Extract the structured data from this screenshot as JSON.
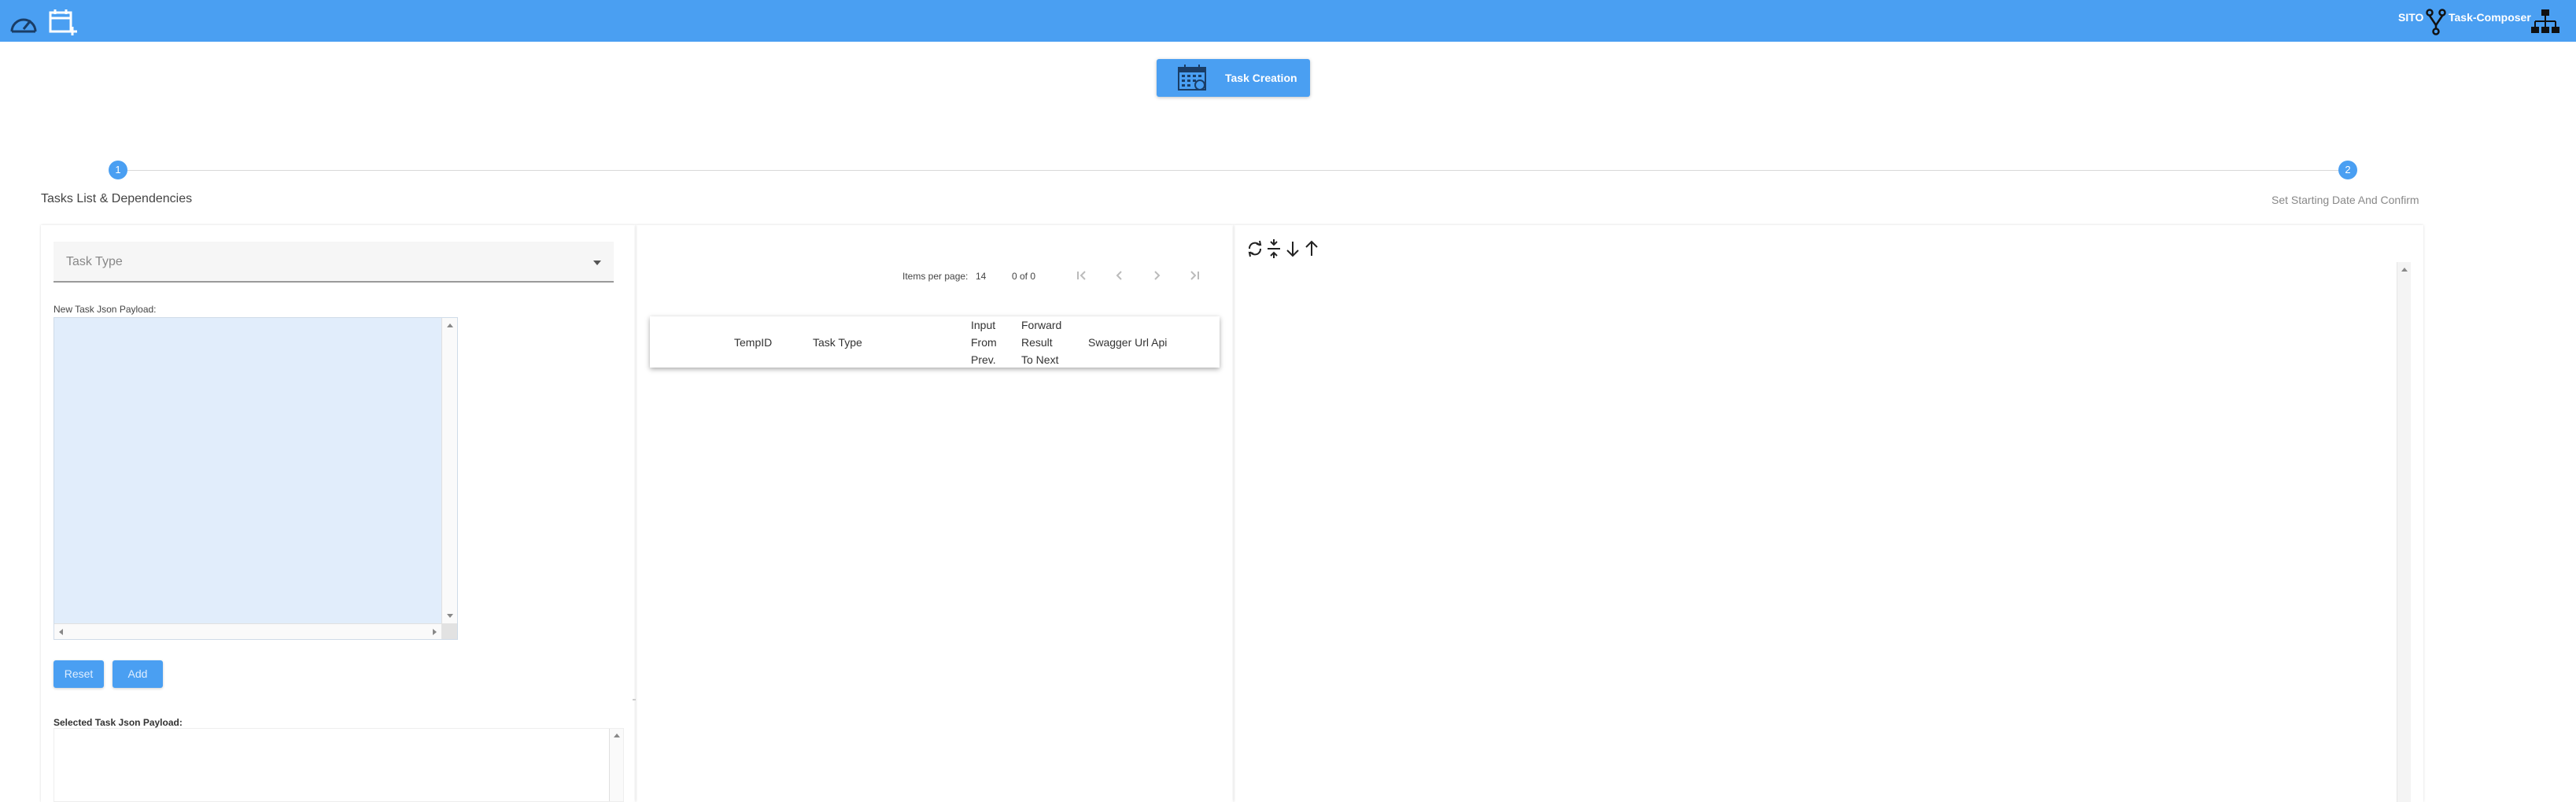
{
  "topbar": {
    "brand_short": "SITO",
    "brand_name": "Task-Composer",
    "icons": [
      "speedometer-icon",
      "calendar-add-icon",
      "fork-icon",
      "sitemap-icon"
    ],
    "color": "#4a9ff2"
  },
  "hero": {
    "label": "Task Creation",
    "icon": "calendar-grid-icon"
  },
  "stepper": {
    "steps": [
      {
        "number": "1",
        "label": "Tasks List & Dependencies"
      },
      {
        "number": "2",
        "label": "Set Starting Date And Confirm"
      }
    ]
  },
  "form": {
    "task_type_placeholder": "Task Type",
    "payload_label": "New Task Json Payload:",
    "reset_label": "Reset",
    "add_label": "Add",
    "selected_payload_label": "Selected Task Json Payload:"
  },
  "paginator": {
    "items_per_page_label": "Items per page:",
    "items_per_page_value": "14",
    "range": "0 of 0",
    "icons": [
      "first-page-icon",
      "prev-page-icon",
      "next-page-icon",
      "last-page-icon"
    ]
  },
  "table": {
    "columns": {
      "temp_id": "TempID",
      "task_type": "Task Type",
      "input_from_prev": [
        "Input",
        "From",
        "Prev."
      ],
      "forward_result": [
        "Forward",
        "Result",
        "To Next"
      ],
      "swagger": "Swagger Url Api"
    }
  },
  "viewer_toolbar": {
    "icons": [
      "refresh-icon",
      "collapse-icon",
      "arrow-down-icon",
      "arrow-up-icon"
    ]
  }
}
